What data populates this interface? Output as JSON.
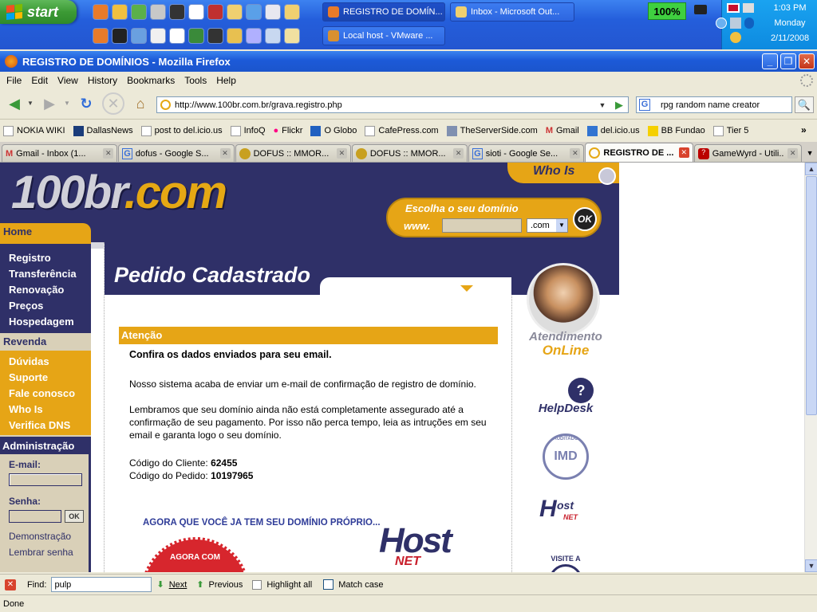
{
  "taskbar": {
    "start_label": "start",
    "tasks": [
      {
        "label": "REGISTRO DE DOMÍN..."
      },
      {
        "label": "Inbox - Microsoft Out..."
      },
      {
        "label": "Local host - VMware ..."
      }
    ],
    "battery": "100%",
    "clock": {
      "time": "1:03 PM",
      "day": "Monday",
      "date": "2/11/2008"
    }
  },
  "window": {
    "title": "REGISTRO DE DOMÍNIOS - Mozilla Firefox"
  },
  "menu": [
    "File",
    "Edit",
    "View",
    "History",
    "Bookmarks",
    "Tools",
    "Help"
  ],
  "nav": {
    "url": "http://www.100br.com.br/grava.registro.php",
    "search_value": "rpg random name creator"
  },
  "bookmarks": [
    "NOKIA WIKI",
    "DallasNews",
    "post to del.icio.us",
    "InfoQ",
    "Flickr",
    "O Globo",
    "CafePress.com",
    "TheServerSide.com",
    "Gmail",
    "del.icio.us",
    "BB Fundao",
    "Tier 5"
  ],
  "tabs": [
    {
      "label": "Gmail - Inbox (1...",
      "color": "#c33"
    },
    {
      "label": "dofus - Google S...",
      "color": "#3a6fd8"
    },
    {
      "label": "DOFUS :: MMOR...",
      "color": "#c8a020"
    },
    {
      "label": "DOFUS :: MMOR...",
      "color": "#c8a020"
    },
    {
      "label": "sioti - Google Se...",
      "color": "#3a6fd8"
    },
    {
      "label": "REGISTRO DE ...",
      "color": "#e5a814"
    },
    {
      "label": "GameWyrd - Utili...",
      "color": "#b00"
    }
  ],
  "site": {
    "logo_main": "100br",
    "logo_tld": ".com",
    "whois": "Who Is",
    "domain_prompt": "Escolha o seu domínio",
    "www_label": "www.",
    "tld_select": ".com",
    "ok": "OK",
    "sidebar": {
      "home": "Home",
      "main_items": [
        "Registro",
        "Transferência",
        "Renovação",
        "Preços",
        "Hospedagem"
      ],
      "revenda": "Revenda",
      "revenda_items": [
        "Dúvidas",
        "Suporte",
        "Fale conosco",
        "Who Is",
        "Verifica DNS"
      ],
      "admin": "Administração",
      "email_label": "E-mail:",
      "senha_label": "Senha:",
      "login_ok": "OK",
      "links": [
        "Demonstração",
        "Lembrar senha"
      ]
    },
    "page_title": "Pedido Cadastrado",
    "attention_label": "Atenção",
    "confirm_line": "Confira os dados enviados para seu email.",
    "para1": "Nosso sistema acaba de enviar um e-mail de confirmação de registro de domínio.",
    "para2": "Lembramos que seu domínio ainda não está completamente assegurado até a confirmação de seu pagamento. Por isso não perca tempo, leia as intruções em seu email e garanta logo o seu domínio.",
    "client_code_label": "Código do Cliente:",
    "client_code": "62455",
    "order_code_label": "Código do Pedido:",
    "order_code": "10197965",
    "promo": "AGORA QUE VOCÊ JA TEM SEU DOMÍNIO PRÓPRIO...",
    "promo_badge": "AGORA COM",
    "hostnet": "Host",
    "hostnet_sub": "NET",
    "right": {
      "atendimento": "Atendimento",
      "online": "OnLine",
      "helpdesk": "HelpDesk",
      "imd": "IMD",
      "auditado": "AUDITADO",
      "visite": "VISITE A"
    }
  },
  "findbar": {
    "label": "Find:",
    "value": "pulp",
    "next": "Next",
    "previous": "Previous",
    "highlight": "Highlight all",
    "match_case": "Match case"
  },
  "status": "Done"
}
